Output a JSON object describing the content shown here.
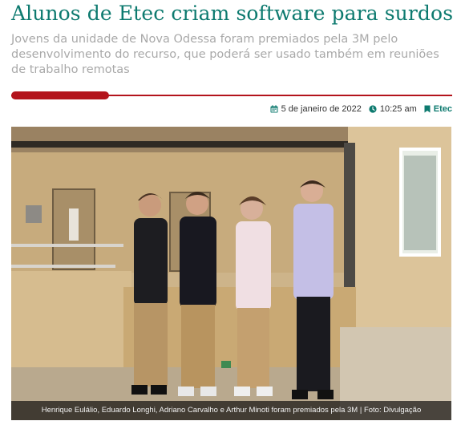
{
  "article": {
    "title": "Alunos de Etec criam software para surdos",
    "subtitle": "Jovens da unidade de Nova Odessa foram premiados pela 3M pelo desenvolvimento do recurso, que poderá ser usado também em reuniões de trabalho remotas",
    "date": "5 de janeiro de 2022",
    "time": "10:25 am",
    "category": "Etec",
    "icons": {
      "date": "calendar-icon",
      "time": "clock-icon",
      "category": "bookmark-icon"
    },
    "photo": {
      "caption": "Henrique Eulálio, Eduardo Longhi, Adriano Carvalho e Arthur Minoti foram premiados pela 3M | Foto: Divulgação"
    }
  },
  "colors": {
    "title": "#0d7a6f",
    "accent_rule": "#b3141c",
    "subtitle": "#a9a9a9"
  }
}
